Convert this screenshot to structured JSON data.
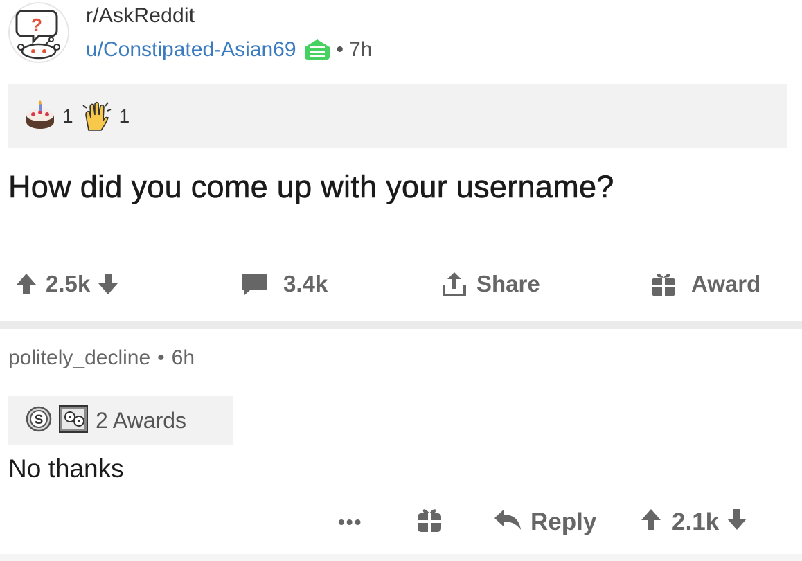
{
  "post": {
    "subreddit": "r/AskReddit",
    "author": "u/Constipated-Asian69",
    "separator": "•",
    "time": "7h",
    "awards": [
      {
        "icon": "cake-award-icon",
        "count": "1"
      },
      {
        "icon": "clapping-hands-award-icon",
        "count": "1"
      }
    ],
    "title": "How did you come up with your username?",
    "score": "2.5k",
    "comments": "3.4k",
    "share_label": "Share",
    "award_label": "Award"
  },
  "comment": {
    "author": "politely_decline",
    "separator": "•",
    "time": "6h",
    "awards_label": "2 Awards",
    "award_icons": [
      "silver-coin-award-icon",
      "face-picture-award-icon"
    ],
    "body": "No thanks",
    "more_label": "•••",
    "reply_label": "Reply",
    "score": "2.1k"
  },
  "colors": {
    "link_blue": "#3b7bbf",
    "mod_green": "#46d160",
    "muted_text": "#666666",
    "panel_gray": "#f2f2f2"
  }
}
